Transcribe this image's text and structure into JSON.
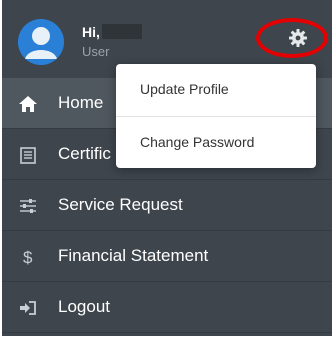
{
  "user": {
    "greeting": "Hi,",
    "role": "User"
  },
  "menu": [
    {
      "label": "Home",
      "icon": "home-icon",
      "active": true
    },
    {
      "label": "Certific",
      "icon": "certificate-icon",
      "active": false
    },
    {
      "label": "Service Request",
      "icon": "sliders-icon",
      "active": false
    },
    {
      "label": "Financial Statement",
      "icon": "dollar-icon",
      "active": false
    },
    {
      "label": "Logout",
      "icon": "logout-icon",
      "active": false
    }
  ],
  "dropdown": {
    "update_profile": "Update Profile",
    "change_password": "Change Password"
  },
  "colors": {
    "sidebar_bg": "#3e454c",
    "active_bg": "#4f575f",
    "avatar": "#2a7fd6",
    "annotation": "#e40000"
  }
}
